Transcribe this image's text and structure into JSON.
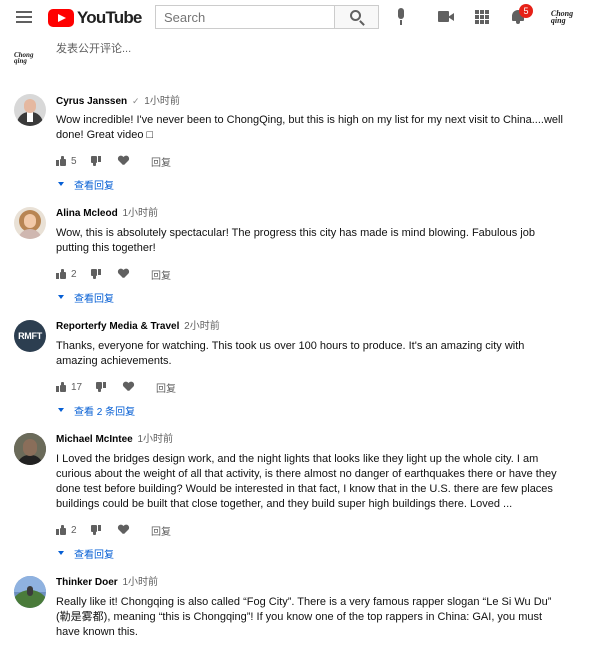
{
  "header": {
    "logo_text": "YouTube",
    "search_placeholder": "Search",
    "notification_count": "5",
    "account_logo": "Chong qing"
  },
  "add_comment": {
    "placeholder": "发表公开评论...",
    "avatar_logo": "Chong qing"
  },
  "comments": [
    {
      "author": "Cyrus Janssen",
      "verified": "✓",
      "time": "1小时前",
      "text": "Wow incredible! I've never been to ChongQing, but this is high on my list for my next visit to China....well done! Great video □",
      "likes": "5",
      "reply_label": "回复",
      "view_replies": "查看回复",
      "avatar": "person-portrait"
    },
    {
      "author": "Alina Mcleod",
      "verified": "",
      "time": "1小时前",
      "text": "Wow, this is absolutely spectacular! The progress this city has made is mind blowing. Fabulous job putting this together!",
      "likes": "2",
      "reply_label": "回复",
      "view_replies": "查看回复",
      "avatar": "person-portrait"
    },
    {
      "author": "Reporterfy Media & Travel",
      "verified": "",
      "time": "2小时前",
      "text": "Thanks, everyone for watching. This took us over 100 hours to produce. It's an amazing city with amazing achievements.",
      "likes": "17",
      "reply_label": "回复",
      "view_replies": "查看 2 条回复",
      "avatar_text": "RMFT"
    },
    {
      "author": "Michael McIntee",
      "verified": "",
      "time": "1小时前",
      "text": "I Loved the bridges design work, and the night lights that looks like they light up the whole city.  I am curious about the weight of all that activity, is there almost no danger of earthquakes there or have they done test before building?  Would be interested in that fact, I know that in the U.S. there are few places buildings could be built that close together, and they build super high buildings there.  Loved ...",
      "likes": "2",
      "reply_label": "回复",
      "view_replies": "查看回复",
      "avatar": "person-portrait"
    },
    {
      "author": "Thinker Doer",
      "verified": "",
      "time": "1小时前",
      "text": "Really like it! Chongqing is also called “Fog City”. There is a very famous rapper slogan “Le Si Wu Du” (勒是雾都), meaning “this is Chongqing”! If you know one of the top rappers in China: GAI, you must have known this.",
      "avatar": "landscape-photo"
    }
  ],
  "colors": {
    "brand_red": "#ff0000",
    "link_blue": "#065fd4",
    "text_secondary": "#606060",
    "badge_red": "#e62117"
  }
}
